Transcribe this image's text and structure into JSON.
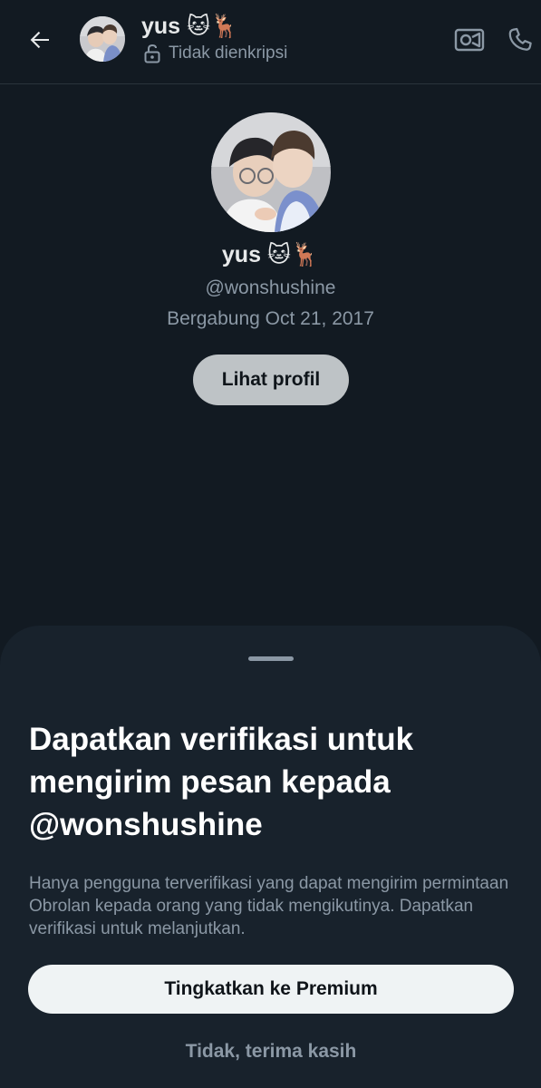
{
  "header": {
    "name": "yus 🐱🦌",
    "encryption_status": "Tidak dienkripsi",
    "icons": {
      "back": "arrow-left-icon",
      "lock": "unlock-icon",
      "video": "video-call-icon",
      "phone": "phone-icon"
    }
  },
  "profile": {
    "name": "yus 🐱🦌",
    "handle": "@wonshushine",
    "joined": "Bergabung Oct 21, 2017",
    "view_profile_label": "Lihat profil"
  },
  "sheet": {
    "title": "Dapatkan verifikasi untuk mengirim pesan kepada @wonshushine",
    "description": "Hanya pengguna terverifikasi yang dapat mengirim permintaan Obrolan kepada orang yang tidak mengikutinya. Dapatkan verifikasi untuk melanjutkan.",
    "primary_button": "Tingkatkan ke Premium",
    "secondary_button": "Tidak, terima kasih"
  },
  "colors": {
    "background": "#121a22",
    "sheet": "#18222c",
    "text_primary": "#e7e9ea",
    "text_secondary": "#8b98a5",
    "button_light": "#eff3f4"
  }
}
